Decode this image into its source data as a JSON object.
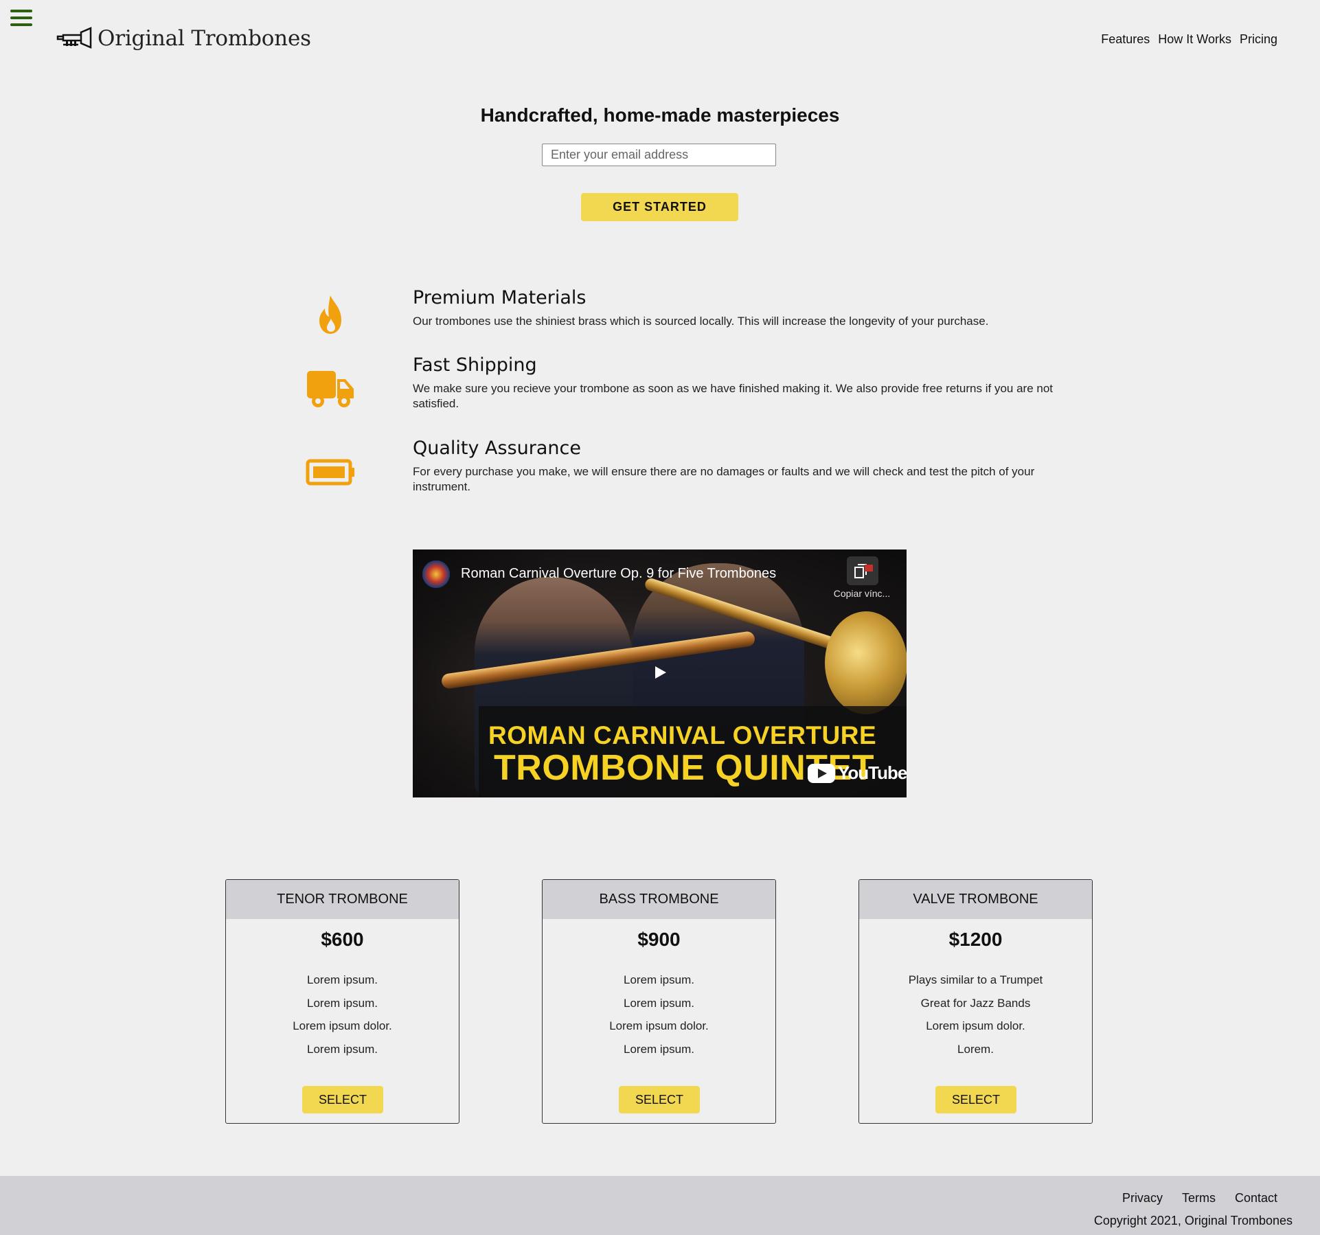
{
  "header": {
    "brand": "Original Trombones",
    "nav": [
      "Features",
      "How It Works",
      "Pricing"
    ]
  },
  "hero": {
    "title": "Handcrafted, home-made masterpieces",
    "email_placeholder": "Enter your email address",
    "cta_label": "GET STARTED"
  },
  "features": [
    {
      "icon": "fire-icon",
      "title": "Premium Materials",
      "text": "Our trombones use the shiniest brass which is sourced locally. This will increase the longevity of your purchase."
    },
    {
      "icon": "truck-icon",
      "title": "Fast Shipping",
      "text": "We make sure you recieve your trombone as soon as we have finished making it. We also provide free returns if you are not satisfied."
    },
    {
      "icon": "battery-icon",
      "title": "Quality Assurance",
      "text": "For every purchase you make, we will ensure there are no damages or faults and we will check and test the pitch of your instrument."
    }
  ],
  "video": {
    "title": "Roman Carnival Overture Op. 9 for Five Trombones",
    "copy_link_label": "Copiar vínc...",
    "caption_line1": "ROMAN CARNIVAL OVERTURE",
    "caption_line2": "TROMBONE QUINTET",
    "youtube_label": "YouTube"
  },
  "pricing": [
    {
      "name": "TENOR TROMBONE",
      "price": "$600",
      "features": [
        "Lorem ipsum.",
        "Lorem ipsum.",
        "Lorem ipsum dolor.",
        "Lorem ipsum."
      ],
      "button": "SELECT"
    },
    {
      "name": "BASS TROMBONE",
      "price": "$900",
      "features": [
        "Lorem ipsum.",
        "Lorem ipsum.",
        "Lorem ipsum dolor.",
        "Lorem ipsum."
      ],
      "button": "SELECT"
    },
    {
      "name": "VALVE TROMBONE",
      "price": "$1200",
      "features": [
        "Plays similar to a Trumpet",
        "Great for Jazz Bands",
        "Lorem ipsum dolor.",
        "Lorem."
      ],
      "button": "SELECT"
    }
  ],
  "footer": {
    "links": [
      "Privacy",
      "Terms",
      "Contact"
    ],
    "copyright": "Copyright 2021, Original Trombones"
  },
  "colors": {
    "accent_yellow": "#f2d850",
    "icon_orange": "#f0a10d",
    "menu_green": "#2d5e12",
    "card_header": "#d0d0d5",
    "background": "#efefef"
  }
}
